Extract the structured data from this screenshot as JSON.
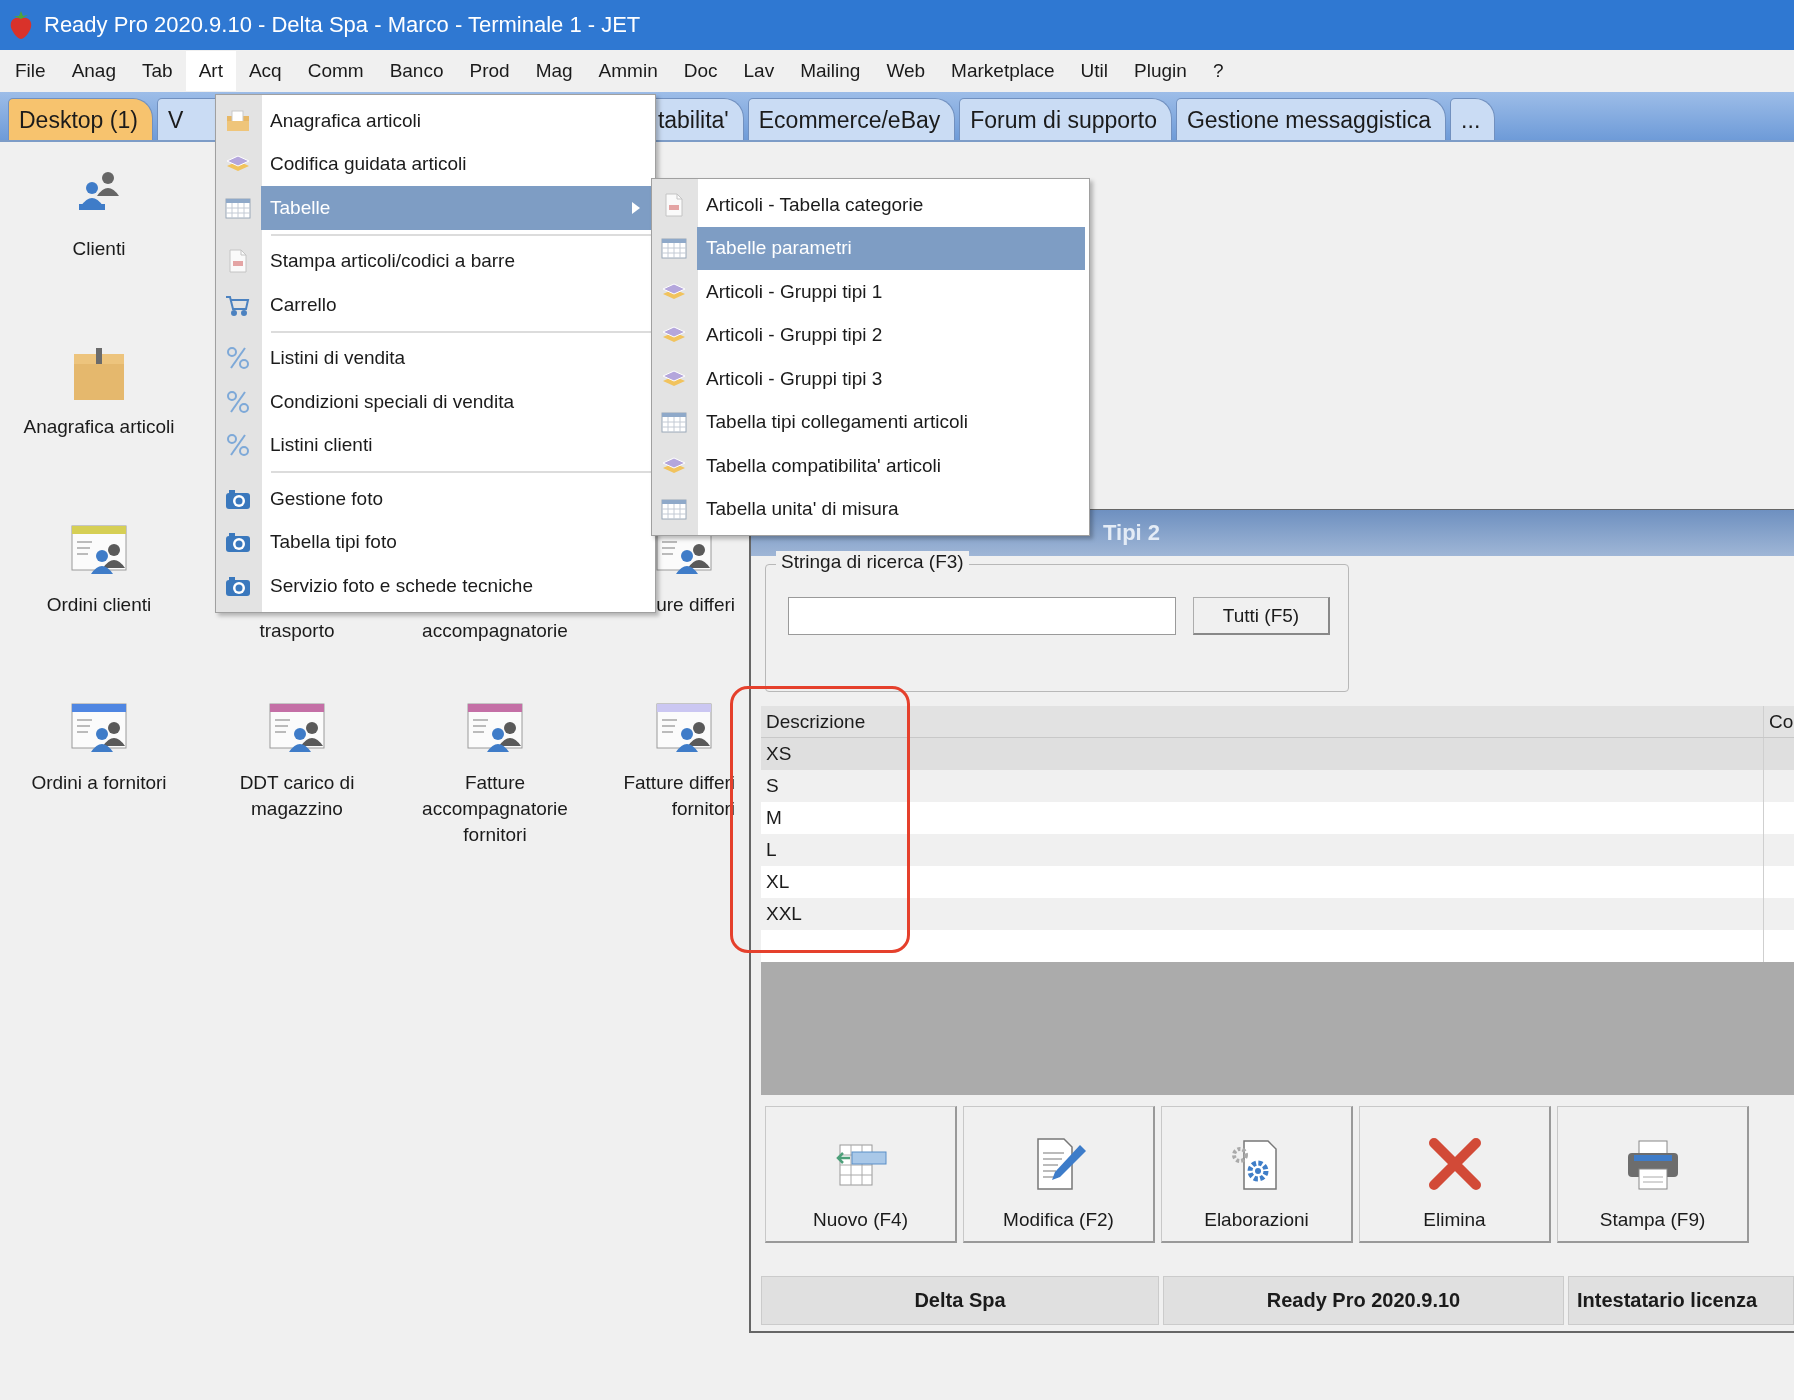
{
  "window": {
    "title": "Ready Pro 2020.9.10 - Delta Spa - Marco - Terminale 1 - JET"
  },
  "menu_bar": [
    {
      "label": "File",
      "selected": false
    },
    {
      "label": "Anag",
      "selected": false
    },
    {
      "label": "Tab",
      "selected": false
    },
    {
      "label": "Art",
      "selected": true
    },
    {
      "label": "Acq",
      "selected": false
    },
    {
      "label": "Comm",
      "selected": false
    },
    {
      "label": "Banco",
      "selected": false
    },
    {
      "label": "Prod",
      "selected": false
    },
    {
      "label": "Mag",
      "selected": false
    },
    {
      "label": "Ammin",
      "selected": false
    },
    {
      "label": "Doc",
      "selected": false
    },
    {
      "label": "Lav",
      "selected": false
    },
    {
      "label": "Mailing",
      "selected": false
    },
    {
      "label": "Web",
      "selected": false
    },
    {
      "label": "Marketplace",
      "selected": false
    },
    {
      "label": "Util",
      "selected": false
    },
    {
      "label": "Plugin",
      "selected": false
    },
    {
      "label": "?",
      "selected": false
    }
  ],
  "tabs": [
    {
      "label": "Desktop (1)",
      "selected": true
    },
    {
      "label": "V",
      "selected": false
    },
    {
      "label": "tabilita'",
      "selected": false
    },
    {
      "label": "Ecommerce/eBay",
      "selected": false
    },
    {
      "label": "Forum di supporto",
      "selected": false
    },
    {
      "label": "Gestione messaggistica",
      "selected": false
    },
    {
      "label": "...",
      "selected": false
    }
  ],
  "desktop": {
    "rows": [
      [
        {
          "kind": "people",
          "label": "Clienti"
        }
      ],
      [
        {
          "kind": "box",
          "label": "Anagrafica articoli"
        }
      ],
      [
        {
          "kind": "card",
          "color": "#d6cf55",
          "label": "Ordini clienti"
        },
        {
          "kind": "label-only",
          "label": "trasporto"
        },
        {
          "kind": "label-only",
          "label": "accompagnatorie"
        },
        {
          "kind": "card",
          "label": "ure differi"
        }
      ],
      [
        {
          "kind": "card",
          "color": "#4f86e2",
          "label": "Ordini a fornitori"
        },
        {
          "kind": "card",
          "color": "#c46fa6",
          "label": "DDT carico di magazzino"
        },
        {
          "kind": "card",
          "color": "#c46fa6",
          "label": "Fatture accompagnatorie fornitori"
        },
        {
          "kind": "card",
          "color": "#cbc7f2",
          "label": "Fatture differi fornitori"
        }
      ]
    ]
  },
  "art_menu": {
    "items": [
      {
        "kind": "folder",
        "label": "Anagrafica articoli",
        "selected": false,
        "submenu": false
      },
      {
        "kind": "layers",
        "label": "Codifica guidata articoli",
        "selected": false,
        "submenu": false
      },
      {
        "kind": "table",
        "label": "Tabelle",
        "selected": true,
        "submenu": true
      },
      {
        "kind": "separator"
      },
      {
        "kind": "document",
        "label": "Stampa articoli/codici a barre",
        "selected": false,
        "submenu": false
      },
      {
        "kind": "cart",
        "label": "Carrello",
        "selected": false,
        "submenu": false
      },
      {
        "kind": "separator"
      },
      {
        "kind": "percent",
        "label": "Listini di vendita",
        "selected": false,
        "submenu": false
      },
      {
        "kind": "percent",
        "label": "Condizioni speciali di vendita",
        "selected": false,
        "submenu": false
      },
      {
        "kind": "percent",
        "label": "Listini clienti",
        "selected": false,
        "submenu": false
      },
      {
        "kind": "separator"
      },
      {
        "kind": "camera",
        "label": "Gestione foto",
        "selected": false,
        "submenu": false
      },
      {
        "kind": "camera",
        "label": "Tabella tipi foto",
        "selected": false,
        "submenu": false
      },
      {
        "kind": "camera",
        "label": "Servizio foto e schede tecniche",
        "selected": false,
        "submenu": false
      }
    ]
  },
  "tables_submenu": {
    "items": [
      {
        "kind": "document",
        "label": "Articoli - Tabella categorie",
        "selected": false,
        "submenu": false
      },
      {
        "kind": "table",
        "label": "Tabelle parametri",
        "selected": true,
        "submenu": false
      },
      {
        "kind": "layers",
        "label": "Articoli - Gruppi tipi 1",
        "selected": false,
        "submenu": false
      },
      {
        "kind": "layers",
        "label": "Articoli - Gruppi tipi 2",
        "selected": false,
        "submenu": false
      },
      {
        "kind": "layers",
        "label": "Articoli - Gruppi tipi 3",
        "selected": false,
        "submenu": false
      },
      {
        "kind": "table",
        "label": "Tabella tipi collegamenti articoli",
        "selected": false,
        "submenu": false
      },
      {
        "kind": "layers",
        "label": "Tabella compatibilita' articoli",
        "selected": false,
        "submenu": false
      },
      {
        "kind": "table",
        "label": "Tabella unita' di misura",
        "selected": false,
        "submenu": false
      }
    ]
  },
  "child_window": {
    "title": "Tipi 2",
    "search": {
      "legend": "Stringa di ricerca (F3)",
      "button": "Tutti (F5)"
    },
    "table": {
      "columns": [
        "Descrizione",
        "Co"
      ],
      "rows": [
        {
          "cells": [
            "XS"
          ],
          "selected": true
        },
        {
          "cells": [
            "S"
          ],
          "selected": false
        },
        {
          "cells": [
            "M"
          ],
          "selected": false
        },
        {
          "cells": [
            "L"
          ],
          "selected": false
        },
        {
          "cells": [
            "XL"
          ],
          "selected": false
        },
        {
          "cells": [
            "XXL"
          ],
          "selected": false
        }
      ]
    },
    "buttons": [
      {
        "kind": "new-row",
        "label": "Nuovo (F4)"
      },
      {
        "kind": "edit",
        "label": "Modifica (F2)"
      },
      {
        "kind": "gear-doc",
        "label": "Elaborazioni"
      },
      {
        "kind": "delete",
        "label": "Elimina"
      },
      {
        "kind": "print",
        "label": "Stampa (F9)"
      }
    ],
    "status_bar": [
      "Delta Spa",
      "Ready Pro 2020.9.10",
      "Intestatario licenza"
    ]
  }
}
